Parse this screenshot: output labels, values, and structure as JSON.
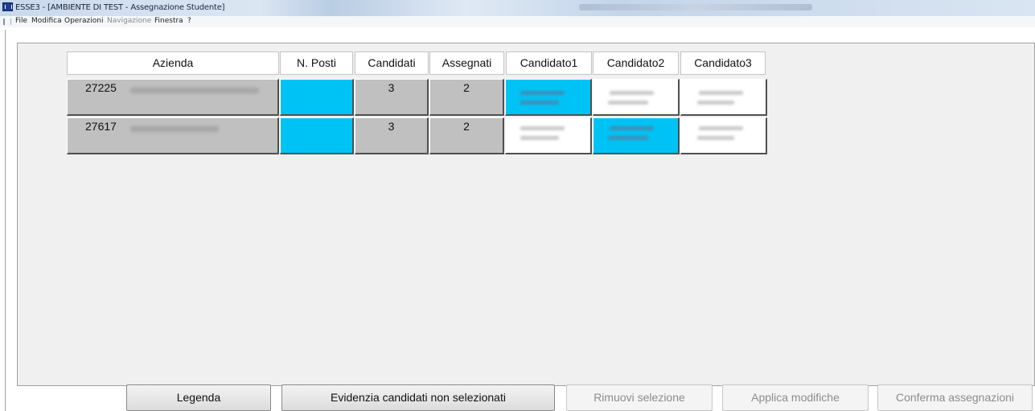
{
  "window": {
    "title": "ESSE3 - [AMBIENTE DI TEST - Assegnazione Studente]"
  },
  "menu": {
    "items": [
      {
        "label": "File",
        "enabled": true
      },
      {
        "label": "Modifica",
        "enabled": true
      },
      {
        "label": "Operazioni",
        "enabled": true
      },
      {
        "label": "Navigazione",
        "enabled": false
      },
      {
        "label": "Finestra",
        "enabled": true
      },
      {
        "label": "?",
        "enabled": true
      }
    ]
  },
  "grid": {
    "columns": [
      "Azienda",
      "N. Posti",
      "Candidati",
      "Assegnati",
      "Candidato1",
      "Candidato2",
      "Candidato3"
    ],
    "rows": [
      {
        "code": "27225",
        "name_redacted": true,
        "posti": "",
        "candidati": "3",
        "assegnati": "2",
        "candidato1_selected": true,
        "candidato2_selected": false,
        "candidato3_selected": false
      },
      {
        "code": "27617",
        "name_redacted": true,
        "posti": "",
        "candidati": "3",
        "assegnati": "2",
        "candidato1_selected": false,
        "candidato2_selected": true,
        "candidato3_selected": false
      }
    ]
  },
  "buttons": {
    "legenda": "Legenda",
    "evidenzia": "Evidenzia candidati non selezionati",
    "rimuovi": "Rimuovi selezione",
    "applica": "Applica modifiche",
    "conferma": "Conferma assegnazioni"
  },
  "colors": {
    "selected": "#00c3f5",
    "cell_gray": "#c0c0c0",
    "panel": "#f0f0f0"
  }
}
